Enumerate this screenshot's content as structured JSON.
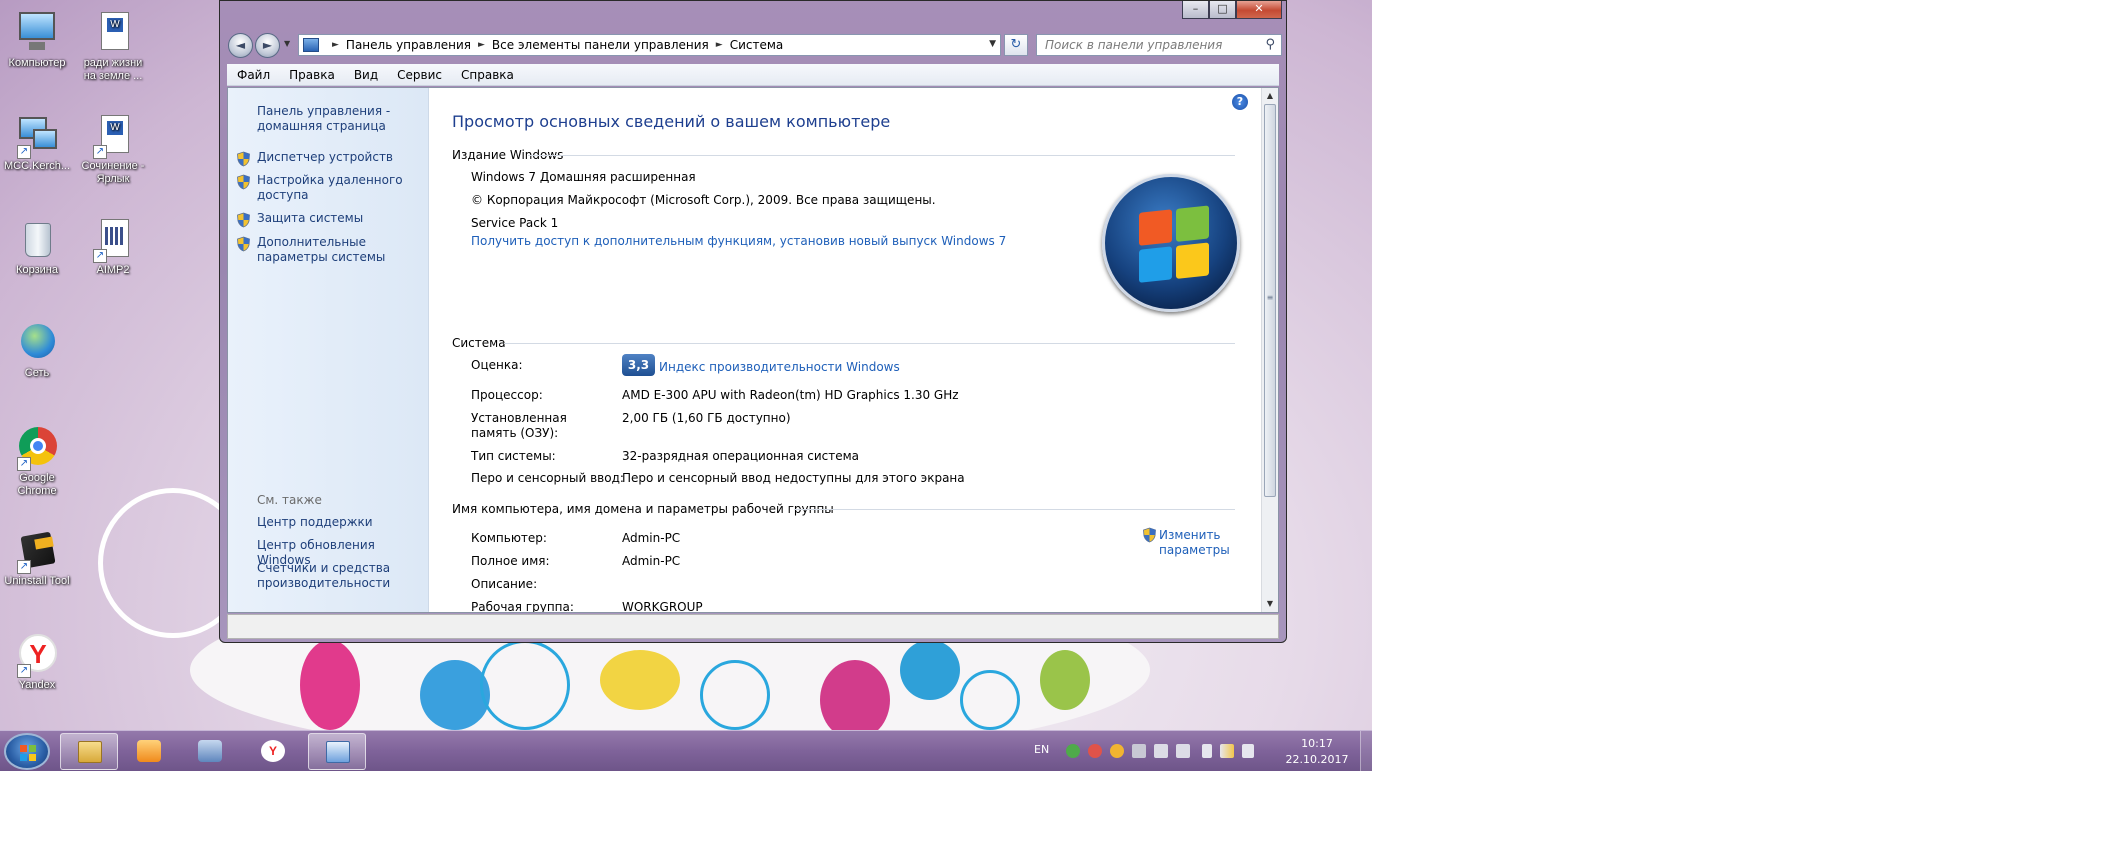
{
  "desktop": {
    "icons": [
      {
        "label": "Компьютер"
      },
      {
        "label": "ради жизни на земле ..."
      },
      {
        "label": "MCC.Kerch..."
      },
      {
        "label": "Сочинение - Ярлык"
      },
      {
        "label": "Корзина"
      },
      {
        "label": "AIMP2"
      },
      {
        "label": "Сеть"
      },
      {
        "label": "Google Chrome"
      },
      {
        "label": "Uninstall Tool"
      },
      {
        "label": "Yandex"
      }
    ]
  },
  "window": {
    "caption": {
      "minimize": "–",
      "maximize": "□",
      "close": "✕"
    },
    "nav": {
      "back": "◄",
      "forward": "►",
      "dropdown": "▼"
    },
    "breadcrumb": [
      "Панель управления",
      "Все элементы панели управления",
      "Система"
    ],
    "breadcrumb_sep": "►",
    "address_dropdown": "▼",
    "refresh": "↻",
    "search": {
      "placeholder": "Поиск в панели управления",
      "icon": "⚲"
    },
    "menu": [
      "Файл",
      "Правка",
      "Вид",
      "Сервис",
      "Справка"
    ]
  },
  "left_pane": {
    "home_link": "Панель управления - домашняя страница",
    "tasks": [
      {
        "label": "Диспетчер устройств",
        "icon": "shield-icon"
      },
      {
        "label": "Настройка удаленного доступа",
        "icon": "shield-icon"
      },
      {
        "label": "Защита системы",
        "icon": "shield-icon"
      },
      {
        "label": "Дополнительные параметры системы",
        "icon": "shield-icon"
      }
    ],
    "see_also_title": "См. также",
    "see_also": [
      "Центр поддержки",
      "Центр обновления Windows",
      "Счетчики и средства производительности"
    ]
  },
  "main": {
    "title": "Просмотр основных сведений о вашем компьютере",
    "help": "?",
    "edition": {
      "heading": "Издание Windows",
      "name": "Windows 7 Домашняя расширенная",
      "copyright": "© Корпорация Майкрософт (Microsoft Corp.), 2009. Все права защищены.",
      "service_pack": "Service Pack 1",
      "upgrade_link": "Получить доступ к дополнительным функциям, установив новый выпуск Windows 7"
    },
    "system": {
      "heading": "Система",
      "rows": [
        {
          "label": "Оценка:",
          "value": "Индекс производительности Windows"
        },
        {
          "label": "Процессор:",
          "value": "AMD E-300 APU with Radeon(tm) HD Graphics   1.30 GHz"
        },
        {
          "label": "Установленная память (ОЗУ):",
          "value": "2,00 ГБ (1,60 ГБ доступно)"
        },
        {
          "label": "Тип системы:",
          "value": "32-разрядная операционная система"
        },
        {
          "label": "Перо и сенсорный ввод:",
          "value": "Перо и сенсорный ввод недоступны для этого экрана"
        }
      ],
      "rating": "3,3"
    },
    "computer": {
      "heading": "Имя компьютера, имя домена и параметры рабочей группы",
      "change_link": "Изменить параметры",
      "rows": [
        {
          "label": "Компьютер:",
          "value": "Admin-PC"
        },
        {
          "label": "Полное имя:",
          "value": "Admin-PC"
        },
        {
          "label": "Описание:",
          "value": ""
        },
        {
          "label": "Рабочая группа:",
          "value": "WORKGROUP"
        }
      ]
    },
    "scroll": {
      "up": "▲",
      "down": "▼",
      "grip": "≡"
    }
  },
  "taskbar": {
    "language": "EN",
    "time": "10:17",
    "date": "22.10.2017",
    "apps": [
      {
        "icon": "folder-icon"
      },
      {
        "icon": "media-player-icon"
      },
      {
        "icon": "speaker-icon"
      },
      {
        "icon": "yandex-icon"
      },
      {
        "icon": "control-panel-icon"
      }
    ]
  },
  "colors": {
    "link": "#1e5fb9",
    "title": "#1e3f8f",
    "taskbar": "#7f639a"
  }
}
